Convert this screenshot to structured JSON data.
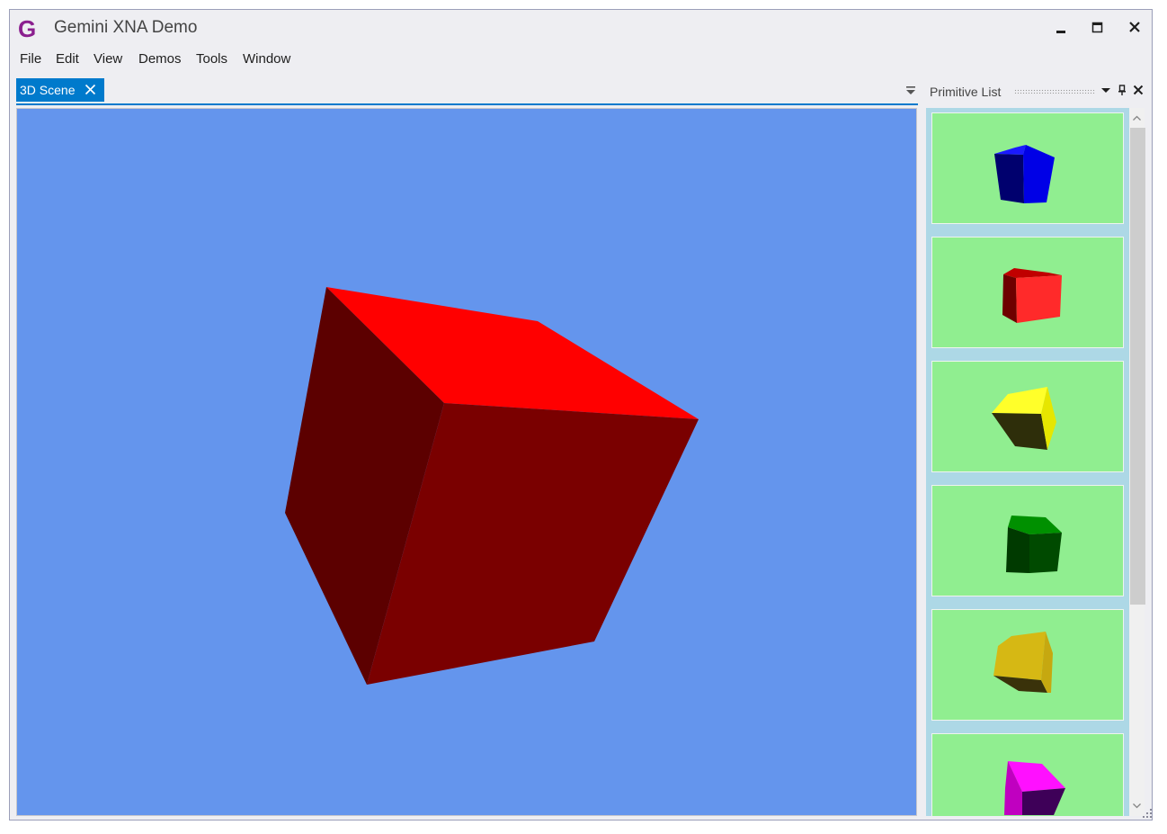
{
  "window": {
    "title": "Gemini XNA Demo",
    "icon": "g-logo-icon"
  },
  "title_controls": [
    "minimize-icon",
    "maximize-icon",
    "close-icon"
  ],
  "menu": [
    "File",
    "Edit",
    "View",
    "Demos",
    "Tools",
    "Window"
  ],
  "document_tab": {
    "label": "3D Scene"
  },
  "scene": {
    "background": "#6495ed",
    "object": "red-cube",
    "colors": {
      "top": "#ff0000",
      "front": "#7a0000",
      "side": "#5c0000"
    }
  },
  "panel": {
    "title": "Primitive List",
    "controls": [
      "dropdown-icon",
      "pin-icon",
      "close-icon"
    ],
    "item_background": "#90ee90",
    "items": [
      {
        "name": "blue-cube",
        "color": "#0000ff"
      },
      {
        "name": "red-cube",
        "color": "#ff0000"
      },
      {
        "name": "yellow-cube",
        "color": "#ffff00"
      },
      {
        "name": "green-cube",
        "color": "#008000"
      },
      {
        "name": "gold-cube",
        "color": "#e0c010"
      },
      {
        "name": "magenta-cube",
        "color": "#ff00ff"
      }
    ]
  },
  "accent": "#007acc"
}
